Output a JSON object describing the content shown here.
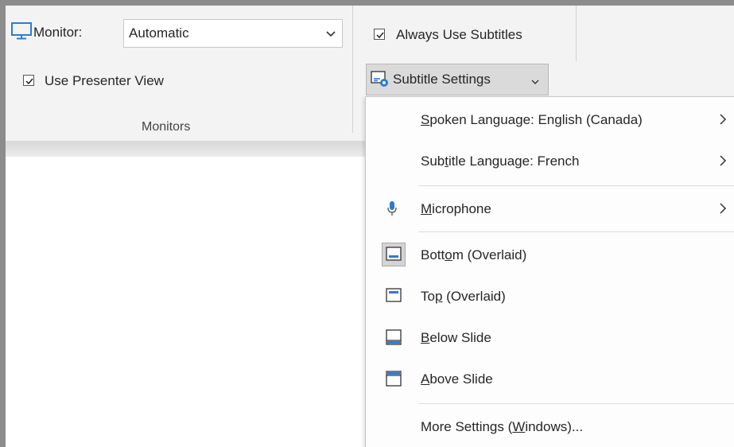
{
  "monitors_group": {
    "monitor_label": "Monitor:",
    "monitor_value": "Automatic",
    "presenter_view_label": "Use Presenter View",
    "group_label": "Monitors"
  },
  "captions_group": {
    "always_use_subtitles_label": "Always Use Subtitles",
    "subtitle_settings_label": "Subtitle Settings"
  },
  "menu": {
    "spoken_language": {
      "pre": "",
      "accel": "S",
      "post": "poken Language: English (Canada)"
    },
    "subtitle_language": {
      "pre": "Sub",
      "accel": "t",
      "post": "itle Language: French"
    },
    "microphone": {
      "pre": "",
      "accel": "M",
      "post": "icrophone"
    },
    "bottom_overlaid": {
      "pre": "Bott",
      "accel": "o",
      "post": "m (Overlaid)"
    },
    "top_overlaid": {
      "pre": "To",
      "accel": "p",
      "post": " (Overlaid)"
    },
    "below_slide": {
      "pre": "",
      "accel": "B",
      "post": "elow Slide"
    },
    "above_slide": {
      "pre": "",
      "accel": "A",
      "post": "bove Slide"
    },
    "more_settings": {
      "pre": "More Settings (",
      "accel": "W",
      "post": "indows)..."
    }
  },
  "colors": {
    "accent": "#2b7cd3",
    "ribbon_bg": "#f3f3f3",
    "selected_bg": "#dadada"
  },
  "icons": {
    "monitor": "monitor-icon",
    "checkmark": "checkmark-icon",
    "dropdown": "chevron-down-icon",
    "subtitle_settings": "subtitle-settings-icon",
    "microphone": "microphone-icon",
    "submenu": "chevron-right-icon",
    "position_bottom": "subtitle-bottom-overlaid-icon",
    "position_top": "subtitle-top-overlaid-icon",
    "position_below": "subtitle-below-slide-icon",
    "position_above": "subtitle-above-slide-icon"
  }
}
